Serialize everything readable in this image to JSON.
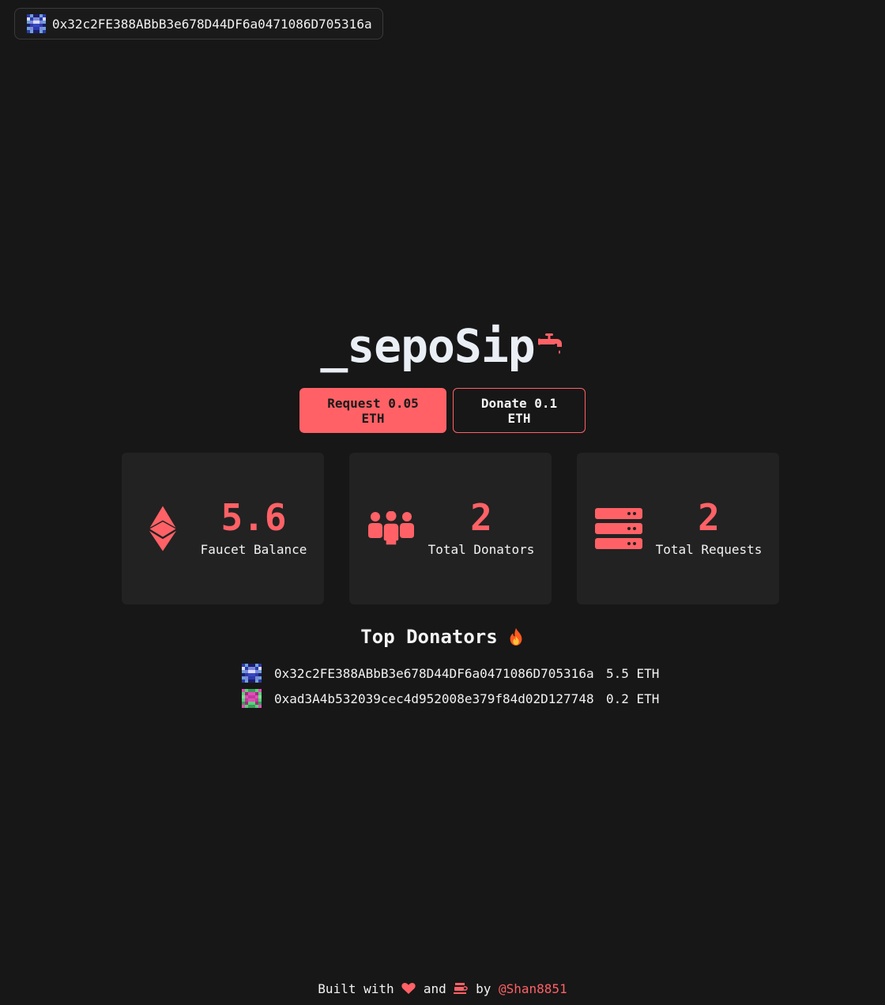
{
  "wallet": {
    "address": "0x32c2FE388ABbB3e678D44DF6a0471086D705316a",
    "avatar_colors": [
      "#2d3aa8",
      "#6fa0d8",
      "#1b1d6b",
      "#7d8ad8",
      "#d9d9ff",
      "#2d3aa8"
    ]
  },
  "brand": {
    "title": "_sepoSip",
    "icon": "faucet-icon",
    "accent": "#ff6166"
  },
  "actions": {
    "request_label": "Request 0.05 ETH",
    "donate_label": "Donate 0.1 ETH"
  },
  "stats": [
    {
      "icon": "ethereum-icon",
      "value": "5.6",
      "label": "Faucet Balance"
    },
    {
      "icon": "users-icon",
      "value": "2",
      "label": "Total Donators"
    },
    {
      "icon": "server-icon",
      "value": "2",
      "label": "Total Requests"
    }
  ],
  "top_donators": {
    "title": "Top Donators",
    "title_icon": "fire-icon",
    "items": [
      {
        "address": "0x32c2FE388ABbB3e678D44DF6a0471086D705316a",
        "amount": "5.5 ETH",
        "avatar": "blue"
      },
      {
        "address": "0xad3A4b532039cec4d952008e379f84d02D127748",
        "amount": "0.2 ETH",
        "avatar": "green-pink"
      }
    ]
  },
  "footer": {
    "built_with": "Built with",
    "and": "and",
    "by": "by",
    "author": "@Shan8851",
    "heart_icon": "heart-icon",
    "coffee_icon": "coffee-icon"
  }
}
